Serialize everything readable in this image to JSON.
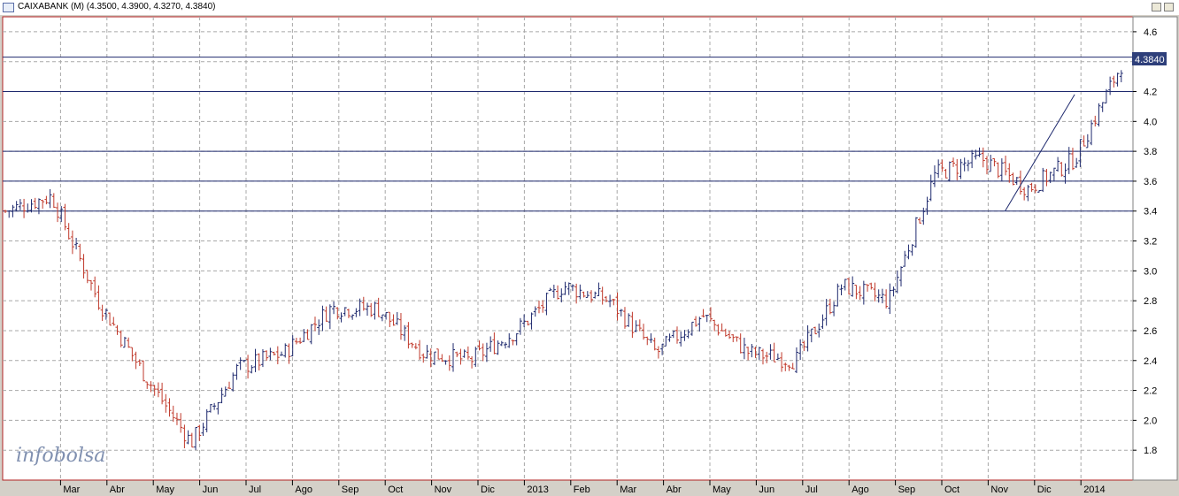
{
  "window": {
    "title": "CAIXABANK (M) (4.3500, 4.3900, 4.3270, 4.3840)"
  },
  "logo": {
    "text": "infobolsa"
  },
  "chart_data": {
    "type": "ohlc",
    "ylim": [
      1.6,
      4.7
    ],
    "yticks": [
      1.8,
      2.0,
      2.2,
      2.4,
      2.6,
      2.8,
      3.0,
      3.2,
      3.4,
      3.6,
      3.8,
      4.0,
      4.2,
      4.4,
      4.6
    ],
    "last_value_label": "4.3840",
    "months": [
      "Mar",
      "Abr",
      "May",
      "Jun",
      "Jul",
      "Ago",
      "Sep",
      "Oct",
      "Nov",
      "Dic",
      "2013",
      "Feb",
      "Mar",
      "Abr",
      "May",
      "Jun",
      "Jul",
      "Ago",
      "Sep",
      "Oct",
      "Nov",
      "Dic",
      "2014"
    ],
    "grid": true,
    "horizontal_levels": [
      4.43,
      4.2,
      3.8,
      3.6,
      3.4
    ],
    "trendline": {
      "from_month": 21.25,
      "from_value": 3.4,
      "to_month": 22.75,
      "to_value": 4.18
    },
    "closes_by_month": [
      3.4,
      3.5,
      2.8,
      2.3,
      1.85,
      2.35,
      2.45,
      2.75,
      2.75,
      2.45,
      2.4,
      2.6,
      2.9,
      2.8,
      2.45,
      2.7,
      2.45,
      2.4,
      2.9,
      2.8,
      3.65,
      3.75,
      3.55,
      3.75,
      4.38
    ],
    "colors": {
      "up": "#1f2a6e",
      "down": "#c0392b",
      "grid": "#a8a8a8",
      "level": "#1f2a6e",
      "label_bg": "#2e3f7a"
    }
  }
}
